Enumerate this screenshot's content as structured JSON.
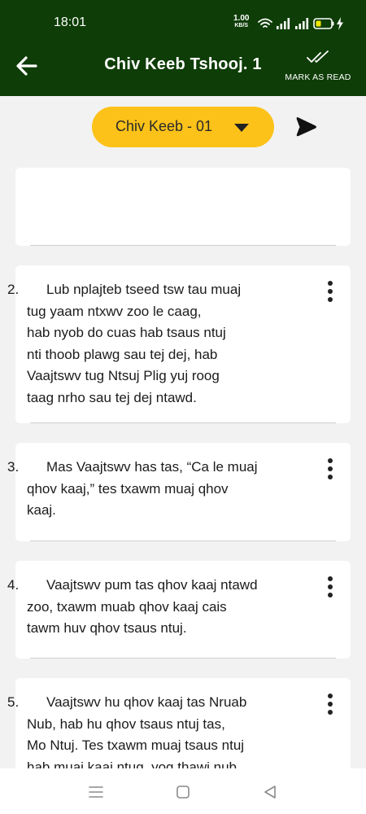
{
  "status_bar": {
    "time": "18:01",
    "speed_value": "1.00",
    "speed_unit": "KB/S",
    "icons": [
      "wifi-icon",
      "signal-icon",
      "signal-icon",
      "battery-charging-icon"
    ]
  },
  "app_bar": {
    "title": "Chiv Keeb Tshooj. 1",
    "back_icon": "arrow-left-icon",
    "mark_read_label": "MARK AS READ",
    "mark_read_icon": "double-check-icon"
  },
  "chapter_select": {
    "selected": "Chiv Keeb - 01",
    "icon": "chevron-down-icon"
  },
  "play_icon": "play-icon",
  "verses": [
    {
      "number": "2.",
      "lines": [
        "Lub nplajteb tseed tsw tau muaj",
        "tug yaam ntxwv zoo le caag,",
        "hab nyob do cuas hab tsaus ntuj",
        "nti thoob plawg sau tej dej, hab",
        "Vaajtswv tug Ntsuj Plig yuj roog",
        "taag nrho sau tej dej ntawd."
      ]
    },
    {
      "number": "3.",
      "lines": [
        "Mas Vaajtswv has tas, “Ca le muaj",
        "qhov kaaj,” tes txawm muaj qhov",
        "kaaj."
      ]
    },
    {
      "number": "4.",
      "lines": [
        "Vaajtswv pum tas qhov kaaj ntawd",
        "zoo, txawm muab qhov kaaj cais",
        "tawm huv qhov tsaus ntuj."
      ]
    },
    {
      "number": "5.",
      "lines": [
        "Vaajtswv hu qhov kaaj tas Nruab",
        "Nub, hab hu qhov tsaus ntuj tas,",
        "Mo Ntuj. Tes txawm muaj tsaus ntuj",
        "hab muaj kaaj ntug, yog thawj nub."
      ]
    }
  ],
  "nav_bar": {
    "items": [
      "menu-icon",
      "home-square-icon",
      "back-triangle-icon"
    ]
  },
  "colors": {
    "header": "#0e3d07",
    "accent": "#fcc219",
    "background": "#f2f2f2",
    "card": "#ffffff"
  }
}
